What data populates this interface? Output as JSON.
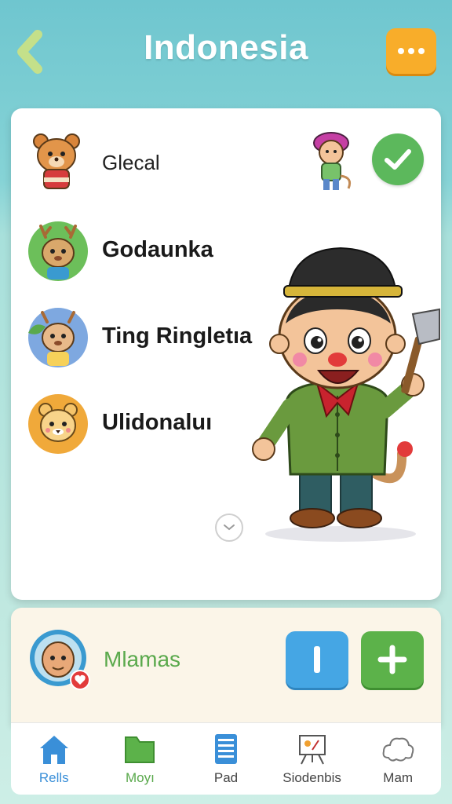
{
  "header": {
    "title": "Indonesia",
    "back_icon": "chevron-left-icon",
    "menu_icon": "more-dots-icon"
  },
  "list": {
    "items": [
      {
        "label": "Glecal",
        "avatar": "bear-avatar"
      },
      {
        "label": "Godaunka",
        "avatar": "deer-avatar"
      },
      {
        "label": "Ting Ringletıa",
        "avatar": "deer-leaf-avatar"
      },
      {
        "label": "Ulidonaluı",
        "avatar": "lion-cub-avatar"
      }
    ],
    "status_icon": "check-icon"
  },
  "profile": {
    "name": "Mlamas",
    "badge_icon": "heart-icon",
    "pause_icon": "pause-icon",
    "add_icon": "plus-icon"
  },
  "nav": {
    "items": [
      {
        "label": "Rells",
        "icon": "home-icon"
      },
      {
        "label": "Moyı",
        "icon": "folder-icon"
      },
      {
        "label": "Pad",
        "icon": "notepad-icon"
      },
      {
        "label": "Siodenbis",
        "icon": "easel-icon"
      },
      {
        "label": "Mam",
        "icon": "cloud-icon"
      }
    ]
  },
  "colors": {
    "accent_orange": "#f8ad2a",
    "check_green": "#5cb85c",
    "pause_blue": "#45a6e4",
    "add_green": "#5cb24a",
    "active_nav": "#3a8fd8"
  }
}
